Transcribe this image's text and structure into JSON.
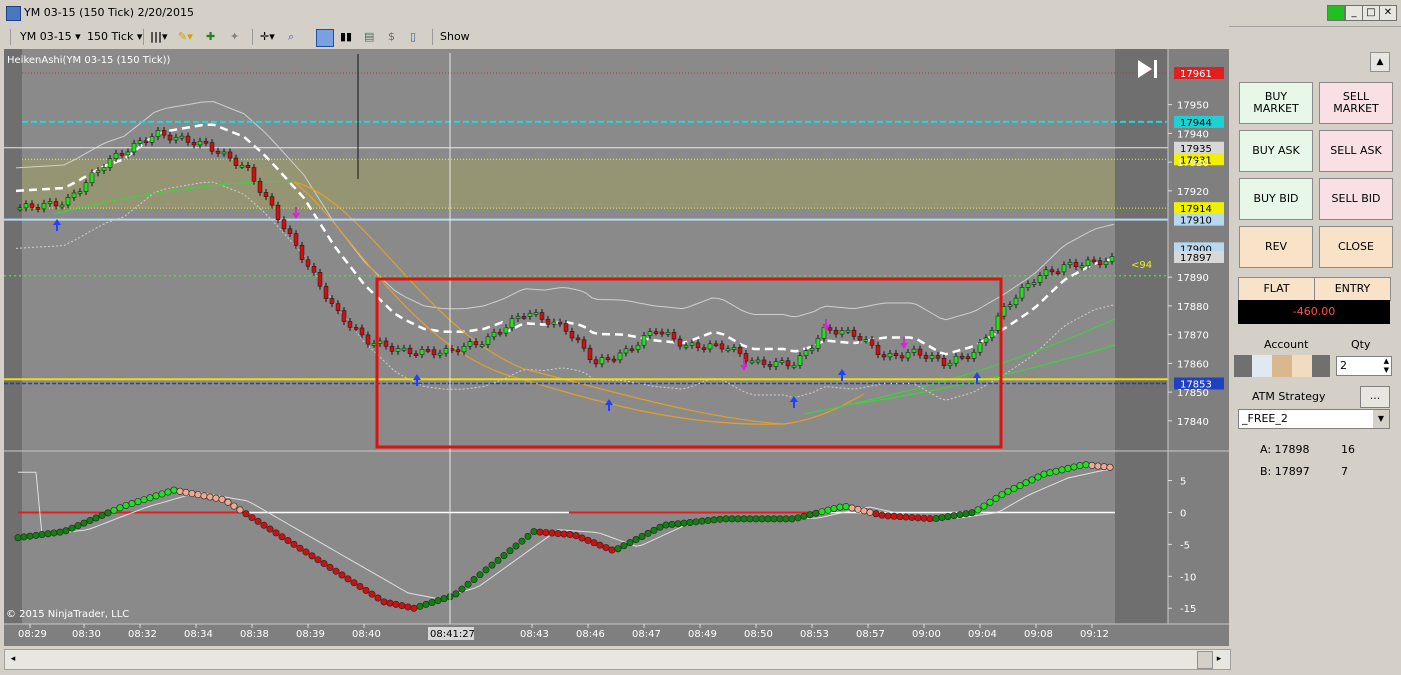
{
  "window": {
    "title": "YM 03-15 (150 Tick)  2/20/2015",
    "controls": [
      "▭",
      "_",
      "□",
      "✕"
    ]
  },
  "toolbar": {
    "instrument": "YM 03-15",
    "interval": "150 Tick",
    "show_label": "Show"
  },
  "chart": {
    "indicator_label": "HeikenAshi(YM 03-15 (150 Tick))",
    "copyright": "© 2015 NinjaTrader, LLC",
    "crosshair_time": "08:41:27",
    "marker_label": "<94",
    "price_tags": [
      {
        "text": "17961",
        "value": 17961,
        "color": "#e02020",
        "fg": "#ffffff"
      },
      {
        "text": "17944",
        "value": 17944,
        "color": "#20d0d0",
        "fg": "#000000"
      },
      {
        "text": "17935",
        "value": 17935,
        "color": "#d8d8d8",
        "fg": "#000000"
      },
      {
        "text": "17931",
        "value": 17931,
        "color": "#f0f000",
        "fg": "#000000"
      },
      {
        "text": "17914",
        "value": 17914,
        "color": "#f0f000",
        "fg": "#000000"
      },
      {
        "text": "17910",
        "value": 17910,
        "color": "#b8d8f0",
        "fg": "#000000"
      },
      {
        "text": "17900",
        "value": 17900,
        "color": "#b8d8f0",
        "fg": "#000000"
      },
      {
        "text": "17897",
        "value": 17897,
        "color": "#d8d8d8",
        "fg": "#000000"
      },
      {
        "text": "17853",
        "value": 17853,
        "color": "#2040c0",
        "fg": "#ffffff"
      }
    ],
    "price_axis": {
      "min": 17833,
      "max": 17961,
      "ticks": [
        "17950",
        "17940",
        "17930",
        "17920",
        "17890",
        "17880",
        "17870",
        "17860",
        "17850",
        "17840"
      ]
    },
    "oscillator_axis": {
      "min": -17,
      "max": 9,
      "ticks": [
        "5",
        "0",
        "-5",
        "-10",
        "-15"
      ]
    },
    "time_labels": [
      "08:29",
      "08:30",
      "08:32",
      "08:34",
      "08:38",
      "08:39",
      "08:40",
      "08:40",
      "08:43",
      "08:46",
      "08:47",
      "08:49",
      "08:50",
      "08:53",
      "08:57",
      "09:00",
      "09:04",
      "09:08",
      "09:12"
    ]
  },
  "panel": {
    "buy_market": "BUY\nMARKET",
    "sell_market": "SELL\nMARKET",
    "buy_ask": "BUY ASK",
    "sell_ask": "SELL ASK",
    "buy_bid": "BUY BID",
    "sell_bid": "SELL BID",
    "rev": "REV",
    "close": "CLOSE",
    "flat": "FLAT",
    "entry": "ENTRY",
    "pnl": "-460.00",
    "account_label": "Account",
    "qty_label": "Qty",
    "qty_value": "2",
    "atm_label": "ATM Strategy",
    "atm_button": "...",
    "atm_value": "_FREE_2",
    "ask_label": "A: 17898",
    "ask_size": "16",
    "bid_label": "B: 17897",
    "bid_size": "7"
  }
}
